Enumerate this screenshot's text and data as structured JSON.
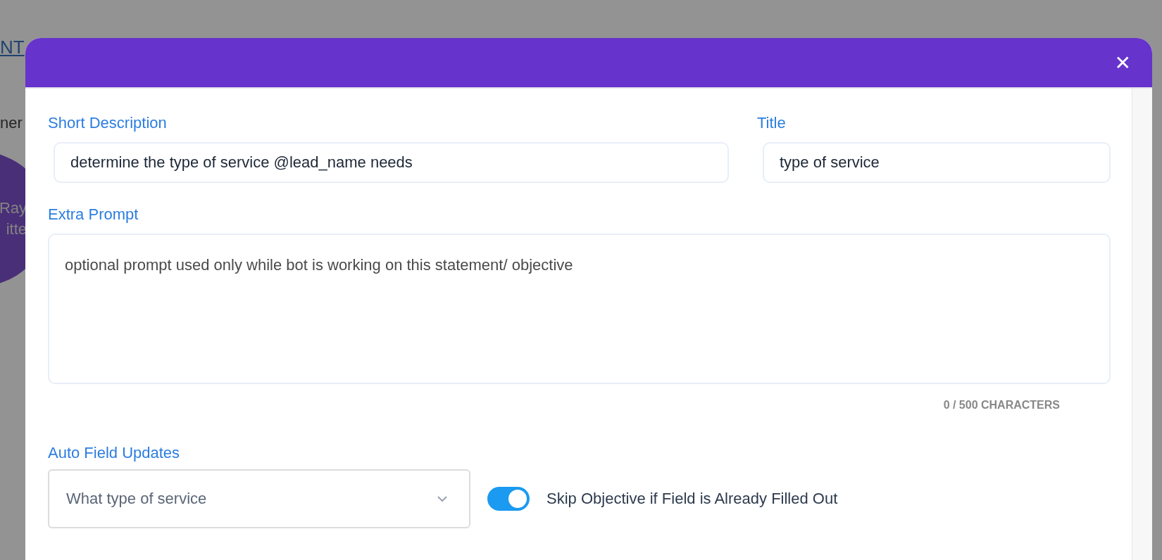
{
  "background": {
    "link": "NT",
    "text": "ner",
    "avatar_lines": [
      "Ray",
      "itte"
    ]
  },
  "modal": {
    "close": "✕",
    "short_description": {
      "label": "Short Description",
      "value": "determine the type of service @lead_name needs"
    },
    "title": {
      "label": "Title",
      "value": "type of service"
    },
    "extra_prompt": {
      "label": "Extra Prompt",
      "placeholder": "optional prompt used only while bot is working on this statement/ objective",
      "counter": "0 / 500 CHARACTERS"
    },
    "auto_field_updates": {
      "label": "Auto Field Updates",
      "value": "What type of service"
    },
    "skip_toggle": {
      "label": "Skip Objective if Field is Already Filled Out",
      "on": true
    }
  }
}
